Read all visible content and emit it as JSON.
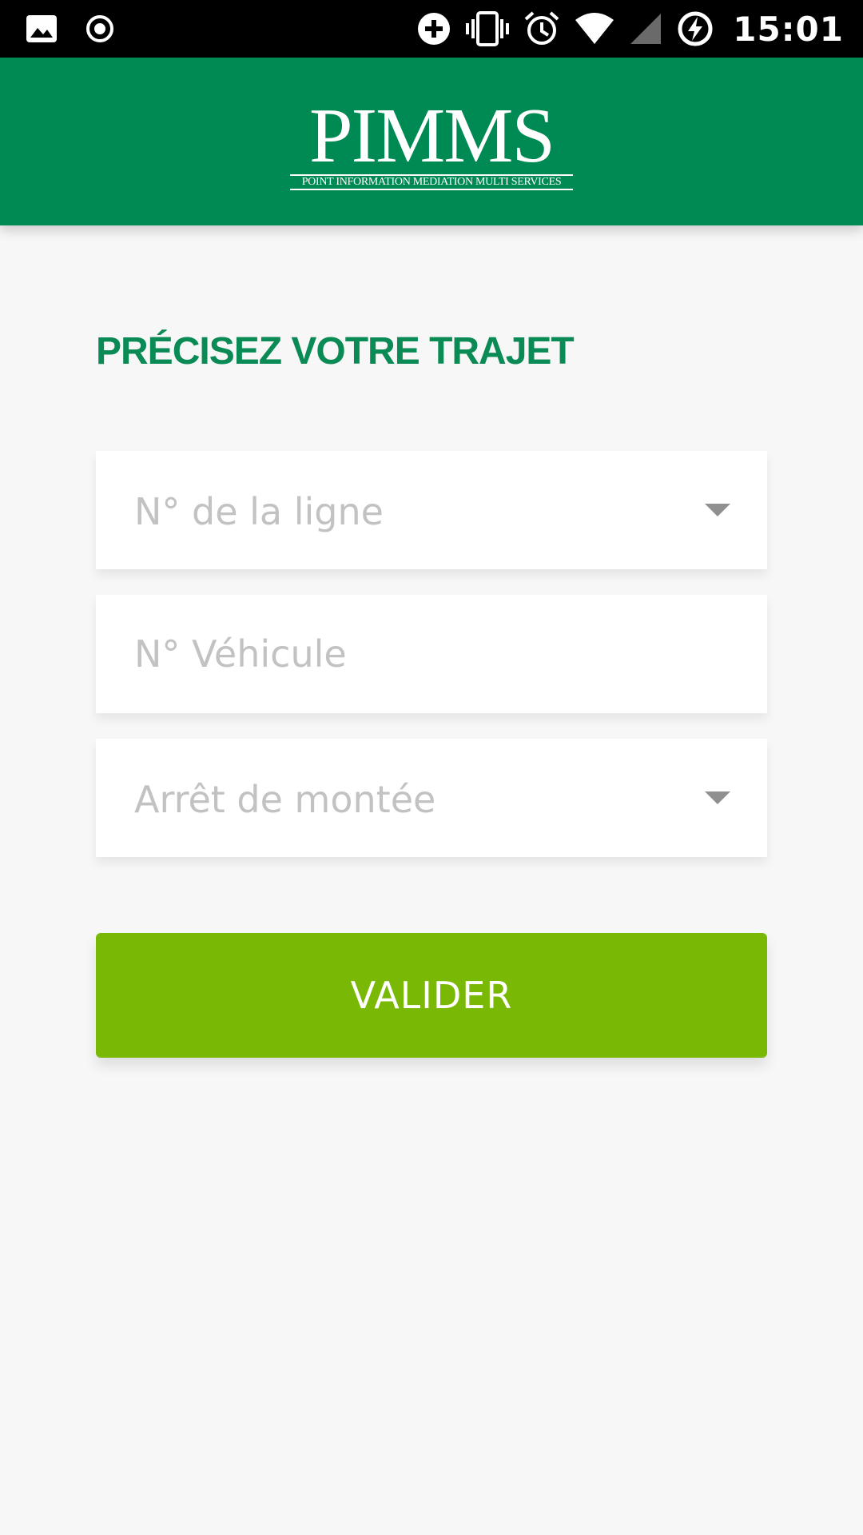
{
  "status_bar": {
    "time": "15:01",
    "icons": [
      "image-icon",
      "record-icon",
      "data-saver-icon",
      "vibrate-icon",
      "alarm-icon",
      "wifi-icon",
      "signal-icon",
      "battery-charging-icon"
    ]
  },
  "header": {
    "logo_text": "PIMMS",
    "logo_subtitle": "POINT INFORMATION MEDIATION MULTI SERVICES",
    "color": "#008a53"
  },
  "form": {
    "title": "PRÉCISEZ VOTRE TRAJET",
    "line_select": {
      "placeholder": "N° de la ligne",
      "value": ""
    },
    "vehicle_input": {
      "placeholder": "N° Véhicule",
      "value": ""
    },
    "stop_select": {
      "placeholder": "Arrêt de montée",
      "value": ""
    },
    "submit_label": "VALIDER",
    "accent_color": "#0a8a55",
    "button_color": "#79b804"
  }
}
